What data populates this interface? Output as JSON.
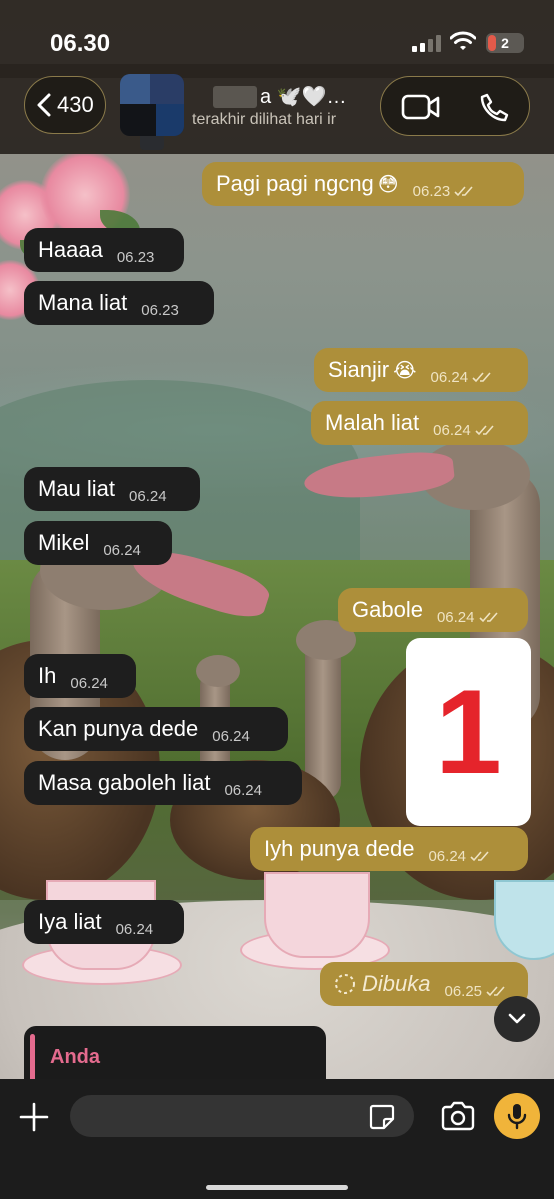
{
  "status_bar": {
    "time": "06.30",
    "battery_level": "2",
    "icons": [
      "signal-icon",
      "wifi-icon",
      "battery-icon"
    ]
  },
  "header": {
    "back_count": "430",
    "contact_name": "a 🕊️🤍…",
    "last_seen": "terakhir dilihat hari ir",
    "icons": [
      "chevron-left-icon",
      "video-call-icon",
      "phone-call-icon"
    ]
  },
  "messages": [
    {
      "direction": "out",
      "text": "Pagi pagi ngcng",
      "emoji": "😳",
      "time": "06.23",
      "status": "read"
    },
    {
      "direction": "in",
      "text": "Haaaa",
      "time": "06.23"
    },
    {
      "direction": "in",
      "text": "Mana liat",
      "time": "06.23"
    },
    {
      "direction": "out",
      "text": "Sianjir",
      "emoji": "😭",
      "time": "06.24",
      "status": "read"
    },
    {
      "direction": "out",
      "text": "Malah liat",
      "time": "06.24",
      "status": "read"
    },
    {
      "direction": "in",
      "text": "Mau liat",
      "time": "06.24"
    },
    {
      "direction": "in",
      "text": "Mikel",
      "time": "06.24"
    },
    {
      "direction": "out",
      "text": "Gabole",
      "time": "06.24",
      "status": "read"
    },
    {
      "direction": "in",
      "text": "Ih",
      "time": "06.24"
    },
    {
      "direction": "in",
      "text": "Kan punya dede",
      "time": "06.24"
    },
    {
      "direction": "in",
      "text": "Masa gaboleh liat",
      "time": "06.24"
    },
    {
      "direction": "out",
      "text": "Iyh punya dede",
      "time": "06.24",
      "status": "read"
    },
    {
      "direction": "in",
      "text": "Iya liat",
      "time": "06.24"
    },
    {
      "direction": "out",
      "text": "Dibuka",
      "time": "06.25",
      "status": "read",
      "view_once": true
    }
  ],
  "sticker": {
    "text": "1"
  },
  "reply_preview": {
    "label": "Anda"
  },
  "input": {
    "placeholder": "",
    "icons": [
      "plus-icon",
      "sticker-icon",
      "camera-icon",
      "microphone-icon"
    ]
  },
  "colors": {
    "outgoing_bubble": "#ad8f3a",
    "incoming_bubble": "#1e1e1e",
    "mic_button": "#f0b43a",
    "reply_accent": "#e46b8e",
    "sticker_number": "#e5242b"
  }
}
